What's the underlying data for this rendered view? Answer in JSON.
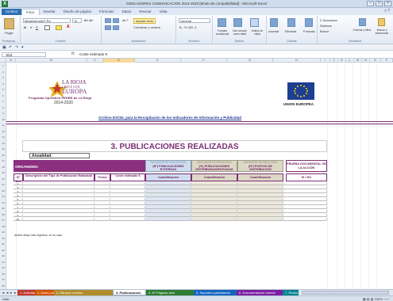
{
  "window": {
    "title": "INDICADORES COMUNICACION 2014-2020  [Modo de compatibilidad] - Microsoft Excel"
  },
  "ribbon_tabs": [
    "Archivo",
    "Inicio",
    "Insertar",
    "Diseño de página",
    "Fórmulas",
    "Datos",
    "Revisar",
    "Vista"
  ],
  "ribbon": {
    "paste_label": "Pegar",
    "clipboard_cap": "Portapap...",
    "font_name": "MetaNormalLF-Ro",
    "font_size": "10",
    "font_cap": "Fuente",
    "wrap_label": "Ajustar texto",
    "merge_label": "Combinar y centrar",
    "alignment_cap": "Alineación",
    "number_format": "General",
    "number_cap": "Número",
    "cond_format": "Formato condicional",
    "table_format": "Dar formato como tabla",
    "cell_styles": "Estilos de celda",
    "styles_cap": "Estilos",
    "insert": "Insertar",
    "delete": "Eliminar",
    "format": "Formato",
    "cells_cap": "Celdas",
    "autosum": "Autosuma",
    "fill": "Rellenar",
    "clear": "Borrar",
    "sort": "Ordenar y filtrar",
    "find": "Buscar y seleccionar",
    "modify_cap": "Modificar"
  },
  "formula_bar": {
    "cell_ref": "B11",
    "fx": "fx",
    "value": "Coste estimado €"
  },
  "columns": [
    "A",
    "B",
    "C",
    "D",
    "E",
    "F",
    "G",
    "H",
    "I",
    "J",
    "K",
    "L",
    "M",
    "N",
    "O",
    "P"
  ],
  "selected_column": "D",
  "rows": [
    "1",
    "2",
    "3",
    "4",
    "5",
    "6",
    "7",
    "8",
    "9",
    "10",
    "11",
    "12",
    "13",
    "14",
    "15",
    "16",
    "17",
    "18",
    "19",
    "20",
    "21",
    "22",
    "23",
    "24",
    "25",
    "26",
    "27",
    "28",
    "29",
    "30",
    "31",
    "32",
    "33",
    "34",
    "35",
    "36",
    "37",
    "38"
  ],
  "sheet": {
    "logo_line1": "LA RIOJA",
    "logo_line2": "CRECE CON",
    "logo_line3": "EUROPA",
    "programa": "Programa Operativo FEDER de La Rioja",
    "years": "2014-2020",
    "eu_label": "UNION EUROPEA",
    "link_text": "Archivo EXCEL para la Recopilación de los Indicadores de Información y Publicidad",
    "main_title": "3. PUBLICACIONES REALIZADAS",
    "anualidad": "Anualidad:",
    "organismo": "ORGANISMO:",
    "hdr_blue_top": "INDICADOR DE REALIZACIÓN",
    "hdr_blue_main": "(Nº) PUBLICACIONES EXTERNAS",
    "hdr_beige1_top": "INDICADOR DE RESULTADO",
    "hdr_beige1_main": "(%) PUBLICACIONES DISTRIBUIDAS/EDITADAS",
    "hdr_beige2_top": "INDICADOR DE RESULTADO",
    "hdr_beige2_main": "(Nº) PUNTOS DE DISTRIBUCIÓN",
    "prueba": "PRUEBA DOCUMENTAL DE LA ACCIÓN",
    "col_n": "Nº Acc",
    "col_desc": "Descripción del Tipo de Publicación Realizada",
    "col_fecha": "Fecha",
    "col_coste": "Coste estimado €",
    "col_cuant1": "Cuantificación",
    "col_cuant2": "Cuantificación",
    "col_cuant3": "Cuantificación",
    "col_sino": "SI / NO",
    "numbers": [
      "1",
      "2",
      "3",
      "4",
      "5",
      "6",
      "7",
      "8",
      "9",
      "10"
    ],
    "note": "Añadir abajo más registros, en su caso"
  },
  "sheet_tabs": [
    {
      "label": "1. Actividad",
      "color": "#c0392b"
    },
    {
      "label": "2. Actos públicos",
      "color": "#d35400"
    },
    {
      "label": "2. Difusión medios",
      "color": "#b08d2c"
    },
    {
      "label": "3. Publicaciones",
      "color": "#ffffff"
    },
    {
      "label": "4. Nº Páginas web",
      "color": "#2e7d32"
    },
    {
      "label": "5. Soportes publicitarios",
      "color": "#1565c0"
    },
    {
      "label": "6. Documentación interna",
      "color": "#7b1fa2"
    },
    {
      "label": "7. Redes",
      "color": "#00838f"
    }
  ],
  "status": {
    "ready": "Listo",
    "zoom": "100%"
  },
  "colors": {
    "purple": "#7b2e75",
    "blue_col": "#cfddee",
    "beige_col": "#ddd8c6",
    "excel_green": "#1f7a3a"
  }
}
